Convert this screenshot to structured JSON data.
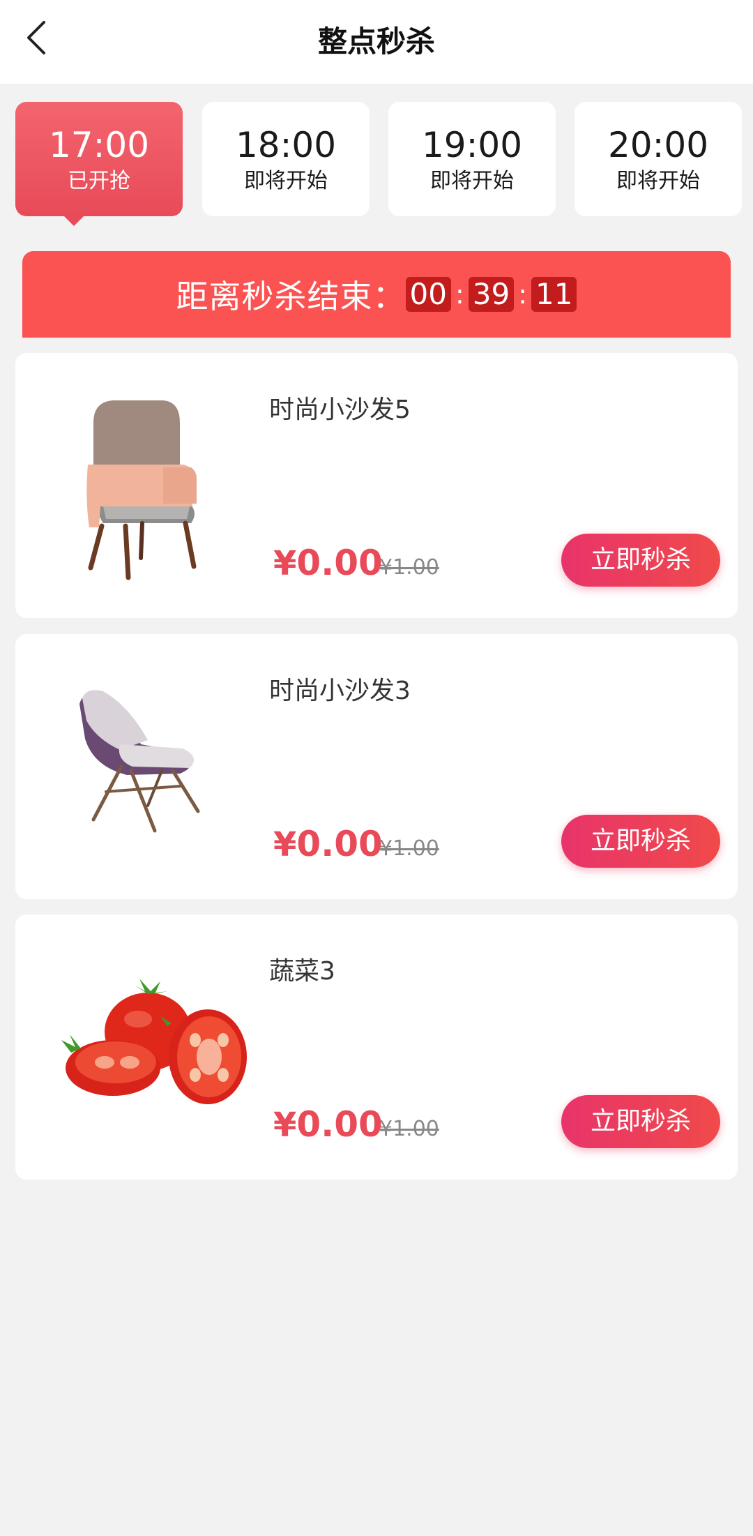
{
  "header": {
    "title": "整点秒杀",
    "back_icon": "chevron-left-icon"
  },
  "tabs": [
    {
      "time": "17:00",
      "status": "已开抢",
      "active": true
    },
    {
      "time": "18:00",
      "status": "即将开始",
      "active": false
    },
    {
      "time": "19:00",
      "status": "即将开始",
      "active": false
    },
    {
      "time": "20:00",
      "status": "即将开始",
      "active": false
    }
  ],
  "countdown": {
    "label": "距离秒杀结束：",
    "hours": "00",
    "minutes": "39",
    "seconds": "11",
    "separator": ":"
  },
  "products": [
    {
      "name": "时尚小沙发5",
      "currency": "¥",
      "price": "0.00",
      "original_price": "¥1.00",
      "button": "立即秒杀",
      "image": "armchair-image"
    },
    {
      "name": "时尚小沙发3",
      "currency": "¥",
      "price": "0.00",
      "original_price": "¥1.00",
      "button": "立即秒杀",
      "image": "lounge-chair-image"
    },
    {
      "name": "蔬菜3",
      "currency": "¥",
      "price": "0.00",
      "original_price": "¥1.00",
      "button": "立即秒杀",
      "image": "tomato-image"
    }
  ],
  "colors": {
    "accent": "#e84a58",
    "banner": "#fb5252",
    "timer_box": "#c21c1c",
    "background": "#f2f2f2"
  }
}
